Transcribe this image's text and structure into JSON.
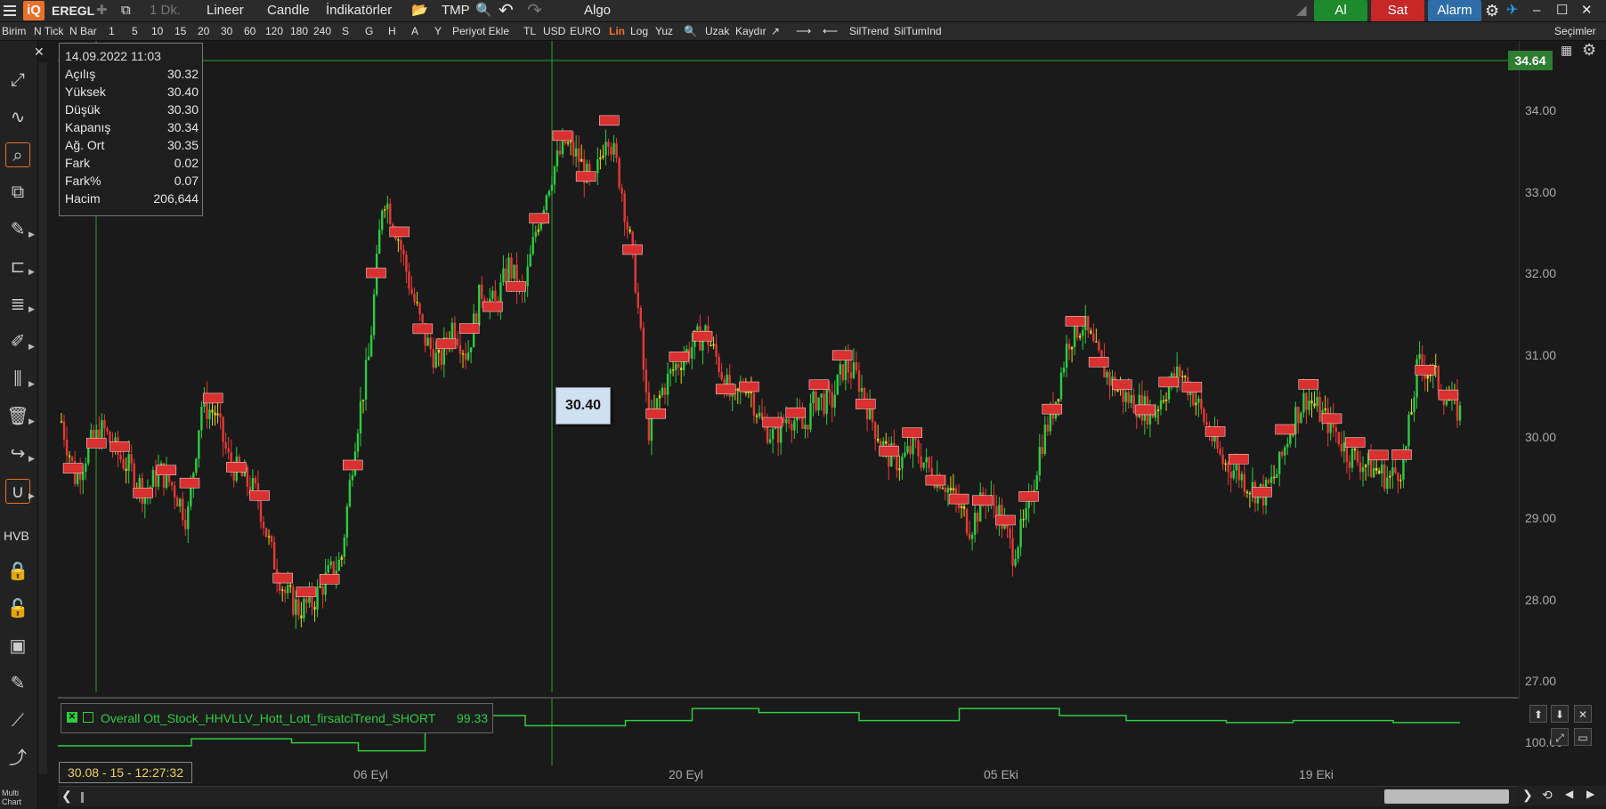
{
  "header": {
    "logo_text": "iQ",
    "symbol": "EREGL",
    "interval": "1 Dk.",
    "scale_mode": "Lineer",
    "chart_type": "Candle",
    "indicators": "İndikatörler",
    "template": "TMP",
    "algo": "Algo",
    "buy_label": "Al",
    "sell_label": "Sat",
    "alarm_label": "Alarm"
  },
  "toolbar2": {
    "items": [
      "Birim",
      "N Tick",
      "N Bar",
      "1",
      "5",
      "10",
      "15",
      "20",
      "30",
      "60",
      "120",
      "180",
      "240",
      "S",
      "G",
      "H",
      "A",
      "Y",
      "Periyot Ekle",
      "TL",
      "USD",
      "EURO",
      "Lin",
      "Log",
      "Yuz",
      "Uzak",
      "Kaydır",
      "SilTrend",
      "SilTumInd"
    ],
    "selected_item": "Lin",
    "selections_label": "Seçimler"
  },
  "sidebar": {
    "hvb_label": "HVB",
    "multichart_label": "Multi Chart"
  },
  "info": {
    "datetime": "14.09.2022 11:03",
    "rows": [
      {
        "label": "Açılış",
        "value": "30.32"
      },
      {
        "label": "Yüksek",
        "value": "30.40"
      },
      {
        "label": "Düşük",
        "value": "30.30"
      },
      {
        "label": "Kapanış",
        "value": "30.34"
      },
      {
        "label": "Ağ. Ort",
        "value": "30.35"
      },
      {
        "label": "Fark",
        "value": "0.02"
      },
      {
        "label": "Fark%",
        "value": "0.07"
      },
      {
        "label": "Hacim",
        "value": "206,644"
      }
    ]
  },
  "price_tag": "34.64",
  "hover_price": "30.40",
  "indicator": {
    "name": "Overall Ott_Stock_HHVLLV_Hott_Lott_firsatciTrend_SHORT",
    "value": "99.33",
    "axis_label": "100.00"
  },
  "cursor_date": "30.08 - 15 - 12:27:32",
  "colors": {
    "up": "#2ecc40",
    "down": "#e53935",
    "mid": "#e0d020",
    "label_bg": "#d93030",
    "grid_line": "#2e9e2e"
  },
  "chart_data": {
    "type": "line",
    "title": "EREGL",
    "ylim": [
      27.0,
      34.6
    ],
    "yticks": [
      "34.00",
      "33.00",
      "32.00",
      "31.00",
      "30.00",
      "29.00",
      "28.00",
      "27.00"
    ],
    "xticks": [
      "06 Eyl",
      "20 Eyl",
      "05 Eki",
      "19 Eki"
    ],
    "series": [
      {
        "name": "EREGL",
        "values": [
          30.2,
          29.5,
          29.9,
          30.1,
          29.8,
          29.6,
          29.3,
          29.6,
          29.4,
          29.0,
          30.4,
          30.3,
          29.7,
          29.5,
          29.3,
          28.6,
          28.1,
          27.9,
          28.0,
          28.3,
          28.5,
          30.0,
          31.0,
          33.0,
          32.5,
          31.8,
          31.2,
          30.9,
          31.4,
          31.0,
          31.8,
          31.6,
          32.1,
          31.7,
          32.6,
          33.2,
          33.6,
          33.4,
          33.0,
          33.8,
          33.1,
          32.0,
          30.1,
          30.6,
          30.9,
          31.1,
          31.3,
          30.9,
          30.4,
          30.7,
          30.2,
          30.0,
          30.3,
          30.1,
          30.5,
          30.4,
          30.9,
          30.7,
          30.2,
          29.8,
          29.7,
          29.9,
          29.6,
          29.5,
          29.2,
          28.9,
          29.3,
          29.1,
          28.6,
          29.0,
          29.9,
          30.4,
          31.2,
          31.4,
          31.0,
          30.7,
          30.5,
          30.4,
          30.3,
          30.6,
          30.8,
          30.5,
          30.1,
          29.7,
          29.6,
          29.4,
          29.3,
          29.6,
          30.2,
          30.5,
          30.3,
          30.1,
          29.8,
          29.7,
          29.6,
          29.5,
          29.7,
          30.9,
          30.8,
          30.5,
          30.3
        ]
      }
    ],
    "signal_labels_count": 60,
    "indicator_series": {
      "name": "Overall Ott_Stock_HHVLLV_Hott_Lott_firsatciTrend_SHORT",
      "values": [
        55,
        55,
        55,
        55,
        62,
        62,
        62,
        58,
        58,
        50,
        50,
        85,
        85,
        85,
        75,
        75,
        75,
        80,
        80,
        92,
        92,
        88,
        88,
        88,
        80,
        80,
        80,
        92,
        92,
        92,
        85,
        85,
        80,
        80,
        80,
        78,
        78,
        80,
        80,
        80,
        78,
        78
      ]
    }
  }
}
